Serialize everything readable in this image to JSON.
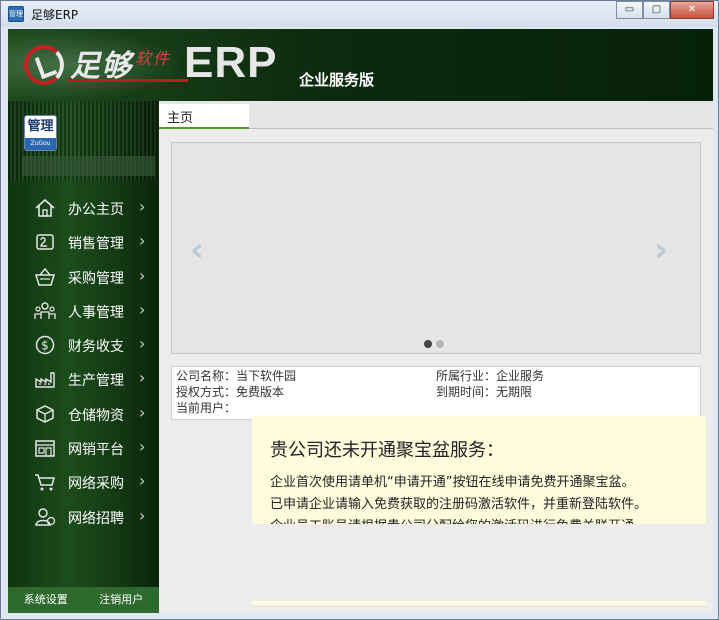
{
  "window": {
    "title": "足够ERP",
    "app_icon_text": "管理",
    "buttons": {
      "minimize": "▭",
      "maximize": "▢",
      "close": "✕"
    }
  },
  "header": {
    "logo_main": "足够",
    "logo_sub": "软件",
    "logo_erp": "ERP",
    "edition": "企业服务版"
  },
  "sidebar": {
    "badge_top": "管理",
    "badge_bottom": "ZuGou",
    "items": [
      {
        "label": "办公主页",
        "icon": "home-icon"
      },
      {
        "label": "销售管理",
        "icon": "sales-icon"
      },
      {
        "label": "采购管理",
        "icon": "basket-icon"
      },
      {
        "label": "人事管理",
        "icon": "people-icon"
      },
      {
        "label": "财务收支",
        "icon": "dollar-icon"
      },
      {
        "label": "生产管理",
        "icon": "factory-icon"
      },
      {
        "label": "仓储物资",
        "icon": "box-icon"
      },
      {
        "label": "网销平台",
        "icon": "store-icon"
      },
      {
        "label": "网络采购",
        "icon": "cart-icon"
      },
      {
        "label": "网络招聘",
        "icon": "recruit-icon"
      }
    ],
    "footer": {
      "settings": "系统设置",
      "logout": "注销用户"
    }
  },
  "main": {
    "tab": "主页",
    "carousel": {
      "prev": "‹",
      "next": "›"
    },
    "info": {
      "company_name": "公司名称：当下软件园",
      "license": "授权方式：免费版本",
      "current_user": "当前用户：",
      "industry": "所属行业：企业服务",
      "expiry": "到期时间：无期限"
    },
    "notice": {
      "title": "贵公司还未开通聚宝盆服务：",
      "line1": "企业首次使用请单机“申请开通”按钮在线申请免费开通聚宝盆。",
      "line2": "已申请企业请输入免费获取的注册码激活软件，并重新登陆软件。",
      "line3": "企业员工账号请根据贵公司分配给您的激活码进行免费关联开通"
    }
  },
  "colors": {
    "accent": "#4a9a2a",
    "sidebar": "#1c4c1c",
    "notice": "#fffcdd"
  }
}
